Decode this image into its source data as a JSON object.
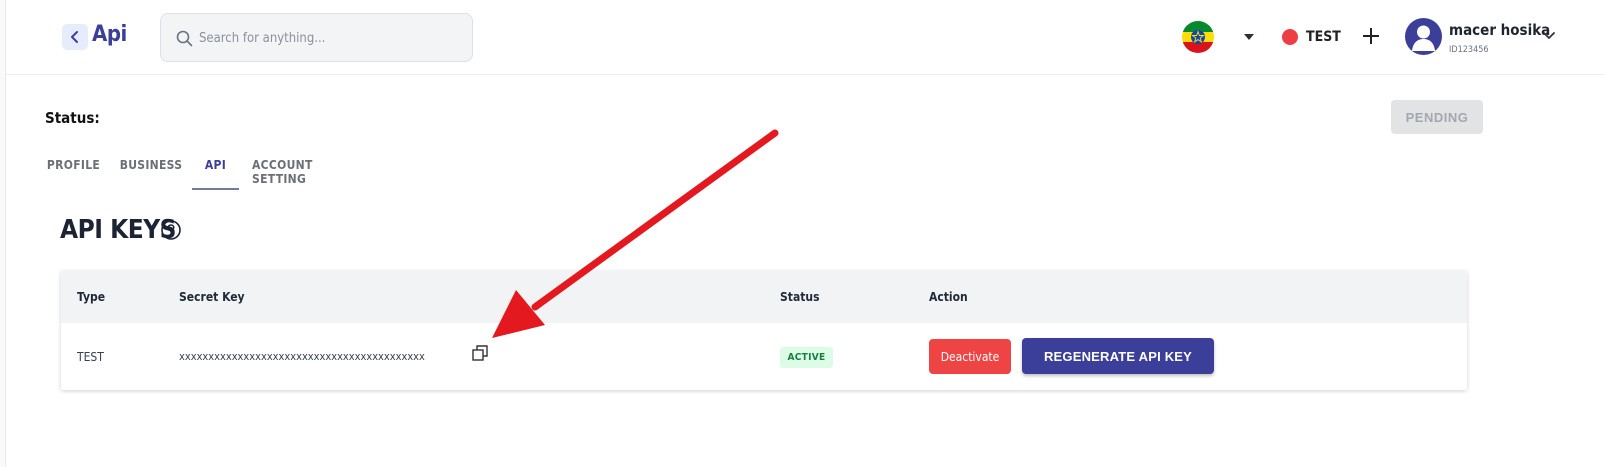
{
  "header": {
    "title": "Api",
    "search_placeholder": "Search for anything...",
    "environment": "TEST",
    "user": {
      "name": "macer hosika",
      "id": "ID123456"
    }
  },
  "status": {
    "label": "Status:",
    "badge": "PENDING"
  },
  "tabs": [
    {
      "label": "PROFILE",
      "active": false
    },
    {
      "label": "BUSINESS",
      "active": false
    },
    {
      "label": "API",
      "active": true
    },
    {
      "label": "ACCOUNT SETTING",
      "active": false
    }
  ],
  "api_keys": {
    "title": "API KEYS",
    "columns": [
      "Type",
      "Secret Key",
      "Status",
      "Action"
    ],
    "rows": [
      {
        "type": "TEST",
        "secret_key": "xxxxxxxxxxxxxxxxxxxxxxxxxxxxxxxxxxxxxxxxxx",
        "status": "ACTIVE",
        "deactivate_label": "Deactivate",
        "regenerate_label": "REGENERATE API KEY"
      }
    ]
  },
  "colors": {
    "brand": "#3b3f99",
    "danger": "#ef4444",
    "success_bg": "#dcfce7",
    "success_text": "#15803d",
    "annotation": "#e3191f"
  },
  "icons": [
    "back-chevron-icon",
    "search-icon",
    "ethiopia-flag-icon",
    "caret-down-icon",
    "plus-icon",
    "user-avatar-icon",
    "chevron-down-icon",
    "help-circle-icon",
    "copy-icon"
  ]
}
